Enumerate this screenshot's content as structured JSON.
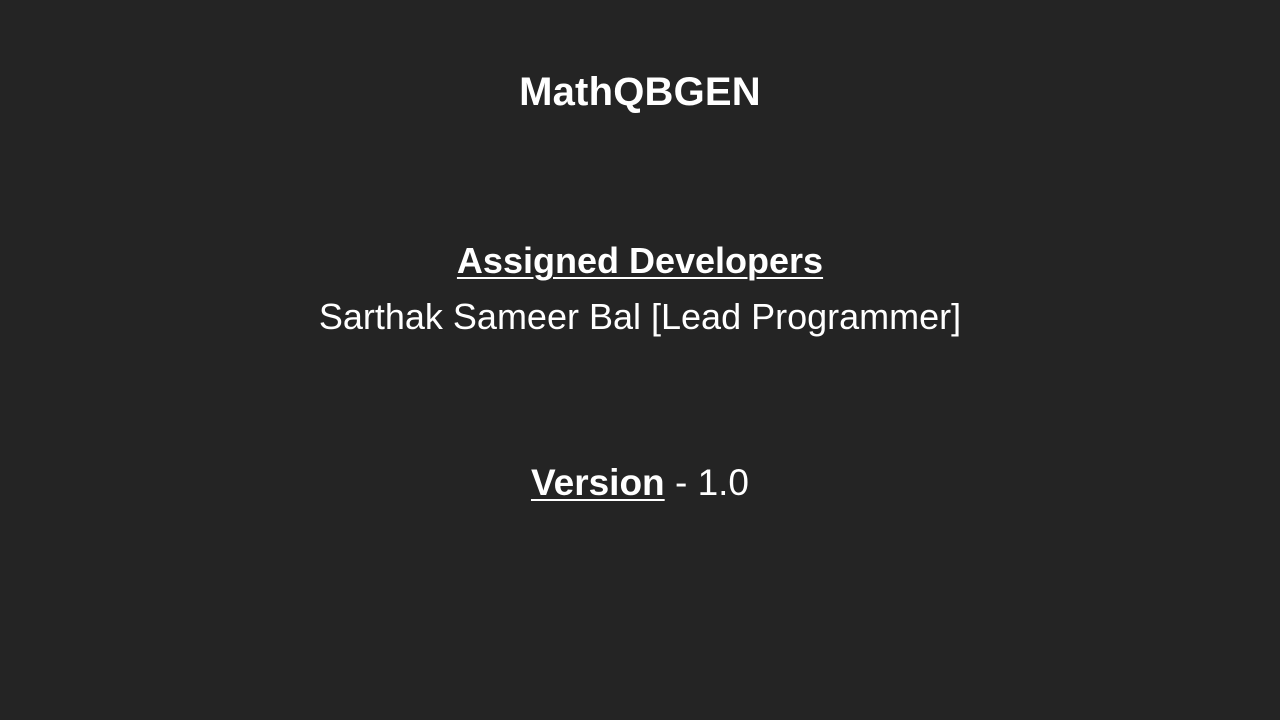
{
  "app": {
    "title": "MathQBGEN"
  },
  "developers": {
    "heading": "Assigned Developers",
    "members": [
      "Sarthak Sameer Bal [Lead Programmer]"
    ]
  },
  "version": {
    "label": "Version",
    "separator": " - ",
    "value": "1.0"
  },
  "theme": {
    "background": "#242424",
    "text": "#ffffff"
  }
}
